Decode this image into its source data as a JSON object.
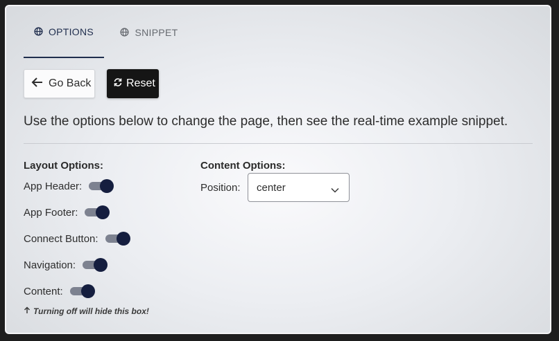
{
  "tabs": [
    {
      "label": "OPTIONS",
      "icon": "globe-icon",
      "active": true
    },
    {
      "label": "SNIPPET",
      "icon": "globe-icon",
      "active": false
    }
  ],
  "buttons": {
    "go_back": "Go Back",
    "reset": "Reset"
  },
  "description": "Use the options below to change the page, then see the real-time example snippet.",
  "layout_options": {
    "heading": "Layout Options:",
    "items": [
      {
        "label": "App Header:",
        "on": true
      },
      {
        "label": "App Footer:",
        "on": true
      },
      {
        "label": "Connect Button:",
        "on": true
      },
      {
        "label": "Navigation:",
        "on": true
      },
      {
        "label": "Content:",
        "on": true
      }
    ],
    "note": "Turning off will hide this box!"
  },
  "content_options": {
    "heading": "Content Options:",
    "position_label": "Position:",
    "position_value": "center"
  },
  "colors": {
    "accent": "#1f2d4d",
    "toggle_knob": "#151e3f",
    "toggle_track": "#7d8290",
    "reset_bg": "#151515"
  }
}
